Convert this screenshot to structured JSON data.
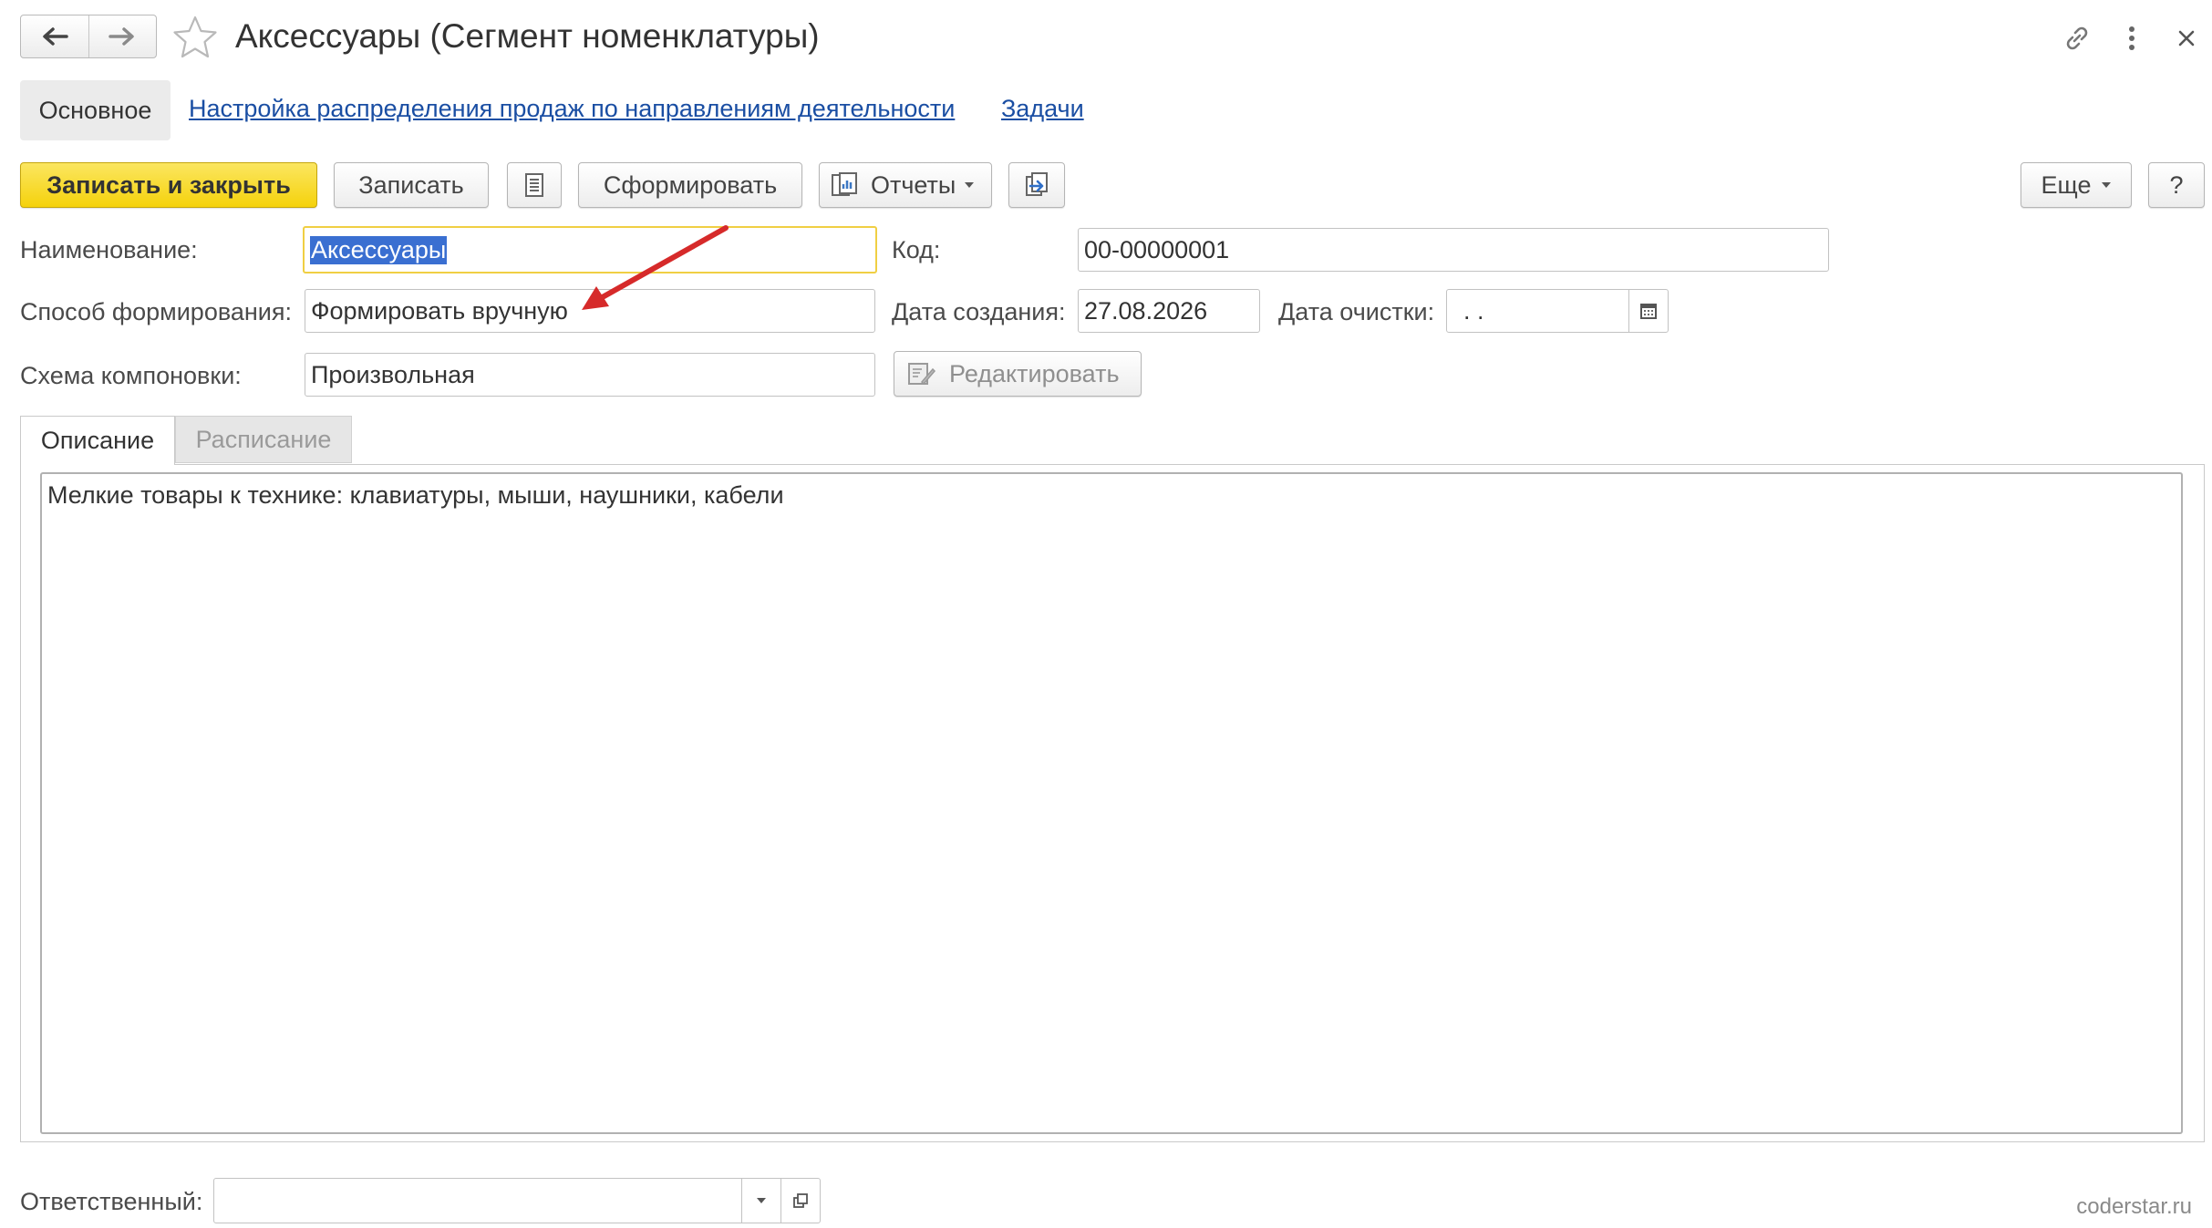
{
  "header": {
    "title": "Аксессуары (Сегмент номенклатуры)"
  },
  "nav_panel": {
    "main_tab": "Основное",
    "links": [
      "Настройка распределения продаж по направлениям деятельности",
      "Задачи"
    ]
  },
  "toolbar": {
    "save_close": "Записать и закрыть",
    "save": "Записать",
    "generate": "Сформировать",
    "reports": "Отчеты",
    "more": "Еще",
    "help": "?"
  },
  "form": {
    "name_label": "Наименование:",
    "name_value": "Аксессуары",
    "code_label": "Код:",
    "code_value": "00-00000001",
    "method_label": "Способ формирования:",
    "method_value": "Формировать вручную",
    "created_label": "Дата создания:",
    "created_value": "27.08.2026",
    "clear_label": "Дата очистки:",
    "clear_value": " .  .",
    "scheme_label": "Схема компоновки:",
    "scheme_value": "Произвольная",
    "edit_button": "Редактировать"
  },
  "tabs": [
    "Описание",
    "Расписание"
  ],
  "description": "Мелкие товары к технике: клавиатуры, мыши, наушники, кабели",
  "footer": {
    "responsible_label": "Ответственный:",
    "responsible_value": "",
    "watermark": "coderstar.ru"
  },
  "colors": {
    "primary_button": "#f5d20c",
    "link": "#1a4ea3",
    "selection": "#3a6fd1",
    "annotation_arrow": "#d62a2a"
  },
  "icons": [
    "back-arrow-icon",
    "forward-arrow-icon",
    "favorite-star-icon",
    "link-icon",
    "more-vertical-icon",
    "close-icon",
    "list-icon",
    "reports-icon",
    "export-icon",
    "calendar-icon",
    "edit-icon",
    "dropdown-icon",
    "open-icon"
  ]
}
